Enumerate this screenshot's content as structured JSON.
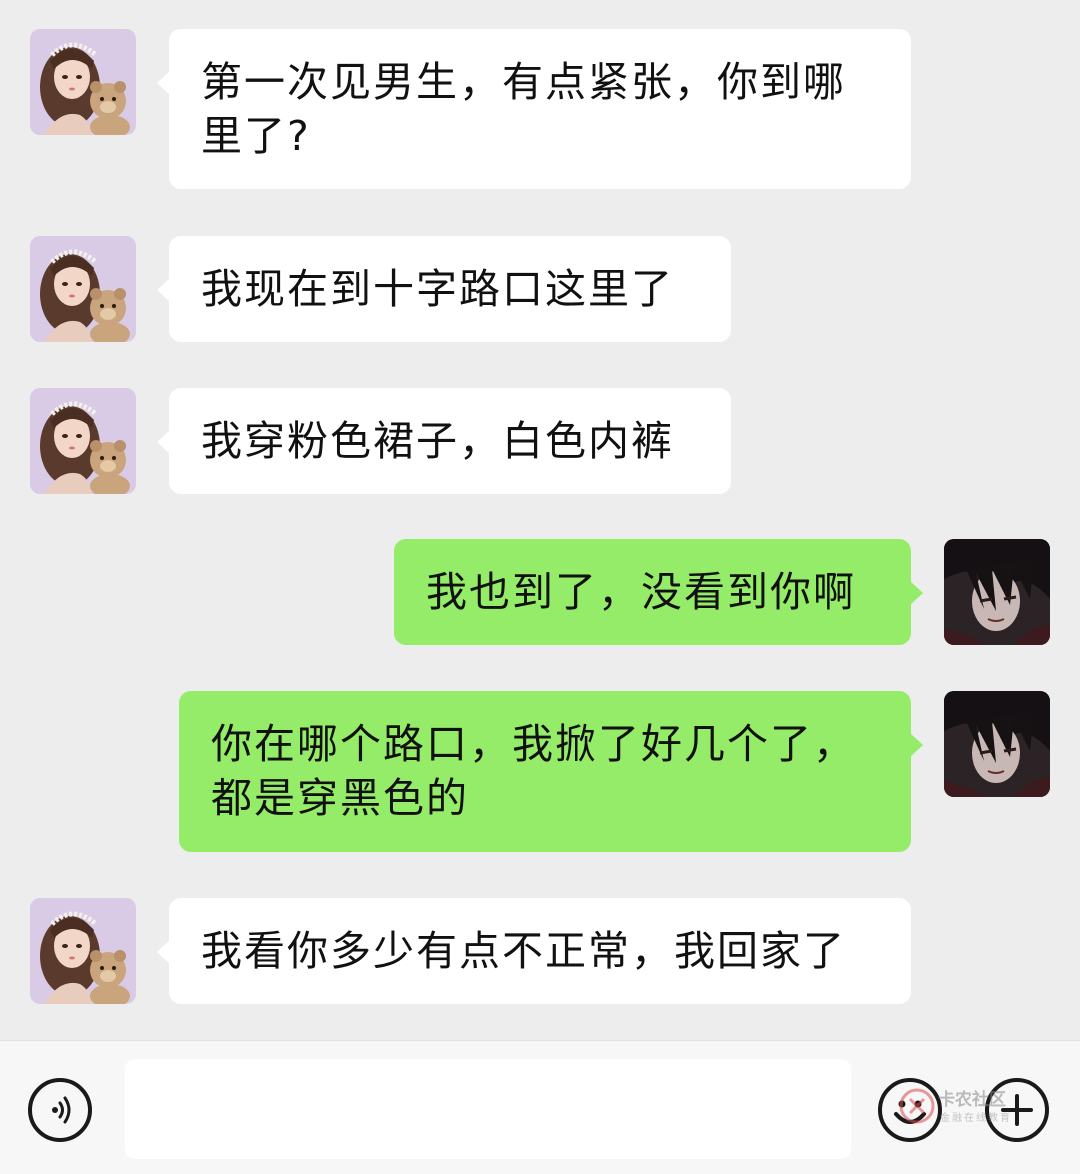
{
  "messages": [
    {
      "from": "her",
      "lines": [
        "第一次见男生，有点紧张，你到哪",
        "里了?"
      ]
    },
    {
      "from": "her",
      "lines": [
        "我现在到十字路口这里了"
      ]
    },
    {
      "from": "her",
      "lines": [
        "我穿粉色裙子，白色内裤"
      ]
    },
    {
      "from": "me",
      "lines": [
        "我也到了，没看到你啊"
      ]
    },
    {
      "from": "me",
      "lines": [
        "你在哪个路口，我掀了好几个了，",
        "都是穿黑色的"
      ]
    },
    {
      "from": "her",
      "lines": [
        "我看你多少有点不正常，我回家了"
      ]
    }
  ],
  "input_bar": {
    "voice_icon": "voice-icon",
    "emoji_icon": "emoji-icon",
    "plus_icon": "plus-icon",
    "input_value": ""
  },
  "watermark": {
    "title": "卡农社区",
    "subtitle": "金融在线教育"
  },
  "colors": {
    "background": "#ededed",
    "incoming_bubble": "#ffffff",
    "outgoing_bubble": "#95ec69",
    "input_bar": "#f7f7f7"
  }
}
